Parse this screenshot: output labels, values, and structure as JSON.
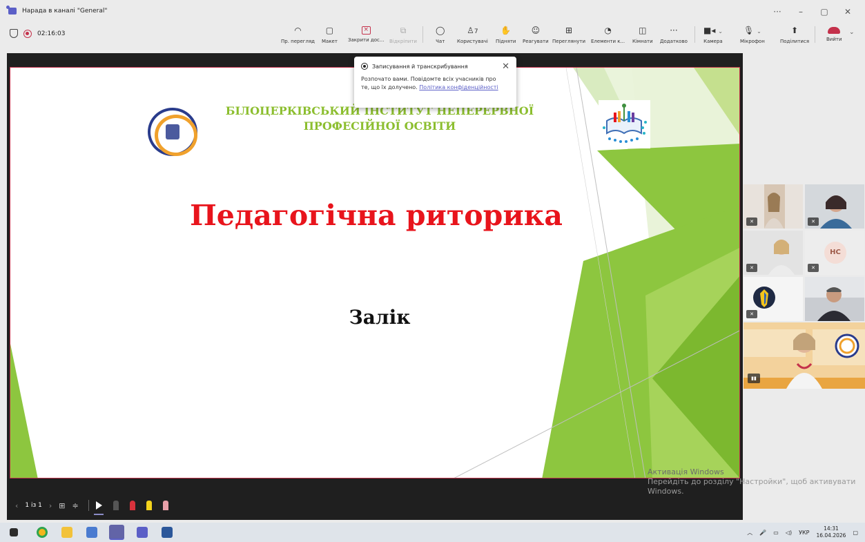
{
  "window": {
    "title": "Нарада в каналі \"General\"",
    "controls": [
      "···",
      "–",
      "▢",
      "✕"
    ]
  },
  "toolbar": {
    "timer": "02:16:03",
    "buttons": [
      {
        "label": "Пр. перегляд",
        "icon": "eye-icon"
      },
      {
        "label": "Макет",
        "icon": "layout-icon"
      },
      {
        "label": "Закрити дос...",
        "icon": "close-share-icon"
      },
      {
        "label": "Відкріпити",
        "icon": "unpin-icon",
        "disabled": true
      },
      {
        "label": "Чат",
        "icon": "chat-icon"
      },
      {
        "label": "Користувачі",
        "icon": "people-icon",
        "count": "7"
      },
      {
        "label": "Підняти",
        "icon": "raise-hand-icon"
      },
      {
        "label": "Реагувати",
        "icon": "react-icon"
      },
      {
        "label": "Переглянути",
        "icon": "view-icon"
      },
      {
        "label": "Елементи к...",
        "icon": "apps-icon"
      },
      {
        "label": "Кімнати",
        "icon": "rooms-icon"
      },
      {
        "label": "Додатково",
        "icon": "more-icon"
      },
      {
        "label": "Камера",
        "icon": "camera-icon"
      },
      {
        "label": "Мікрофон",
        "icon": "mic-icon"
      },
      {
        "label": "Поділитися",
        "icon": "share-icon"
      },
      {
        "label": "Вийти",
        "icon": "leave-icon"
      }
    ]
  },
  "popup": {
    "title": "Записування й транскрибування",
    "body": "Розпочато вами. Повідомте всіх учасників про те, що їх долучено.",
    "link": "Політика конфіденційності"
  },
  "slide": {
    "institute_line1": "БІЛОЦЕРКІВСЬКИЙ ІНСТИТУТ НЕПЕРЕРВНОЇ",
    "institute_line2": "ПРОФЕСІЙНОЇ ОСВІТИ",
    "title": "Педагогічна риторика",
    "subtitle": "Залік",
    "accent_colors": [
      "#8dc63f",
      "#c5e08e",
      "#e6f2d0",
      "#b8d88a"
    ]
  },
  "slide_controls": {
    "counter": "1 із 1"
  },
  "watermark": {
    "line1": "Активація Windows",
    "line2": "Перейдіть до розділу \"Настройки\", щоб активувати",
    "line3": "Windows."
  },
  "participants": {
    "initials": "НС"
  },
  "taskbar": {
    "lang": "УКР",
    "time": "14:31",
    "date": "16.04.2026"
  }
}
